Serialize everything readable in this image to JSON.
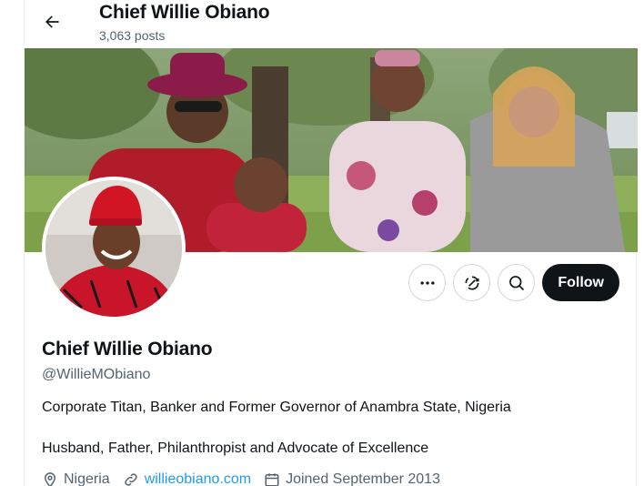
{
  "header": {
    "title": "Chief Willie Obiano",
    "posts": "3,063 posts"
  },
  "actions": {
    "follow_label": "Follow"
  },
  "profile": {
    "name": "Chief Willie Obiano",
    "handle": "@WillieMObiano",
    "bio_line1": "Corporate Titan, Banker and Former Governor of Anambra State, Nigeria",
    "bio_line2": "Husband, Father, Philanthropist and Advocate of Excellence",
    "location": "Nigeria",
    "website": "willieobiano.com",
    "joined": "Joined September 2013"
  },
  "colors": {
    "text": "#0f1419",
    "muted": "#536471",
    "link": "#1d9bf0",
    "button_dark": "#0f1419",
    "border": "#cfd9de"
  },
  "icons": [
    "back-arrow-icon",
    "more-icon",
    "subscribe-icon",
    "search-icon",
    "location-icon",
    "link-icon",
    "calendar-icon"
  ]
}
